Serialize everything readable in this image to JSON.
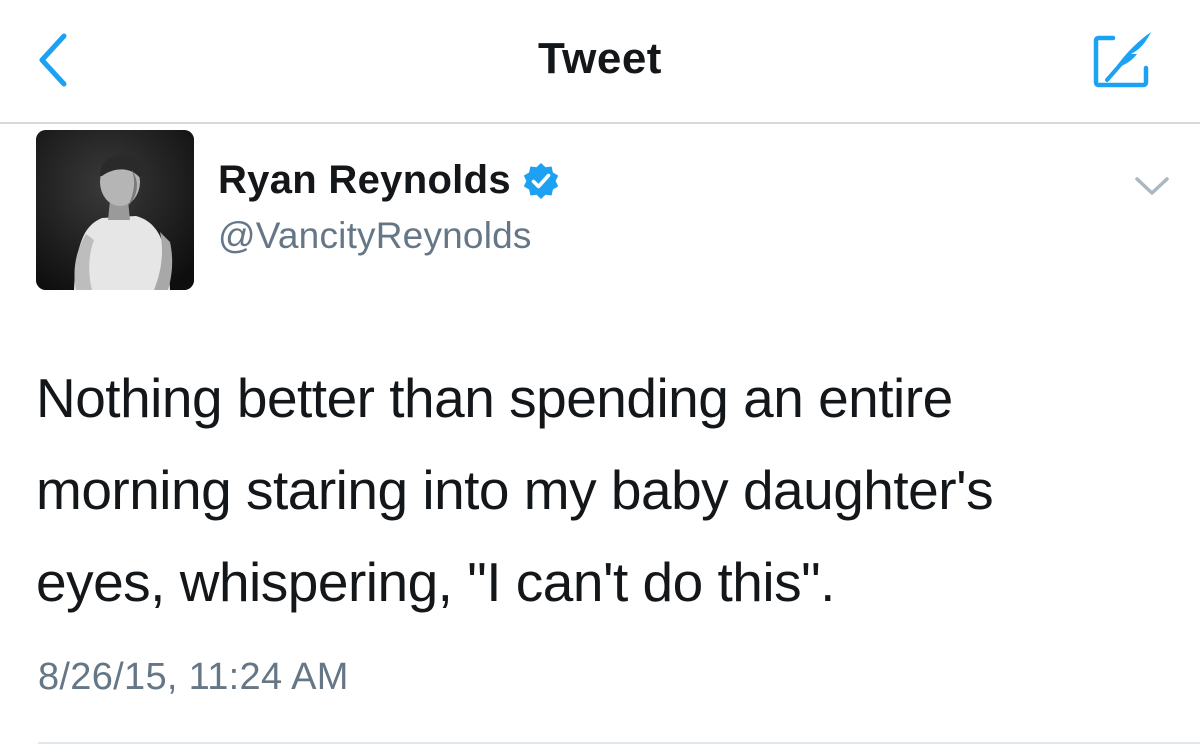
{
  "navbar": {
    "back_icon": "chevron-left-icon",
    "title": "Tweet",
    "compose_icon": "compose-quill-icon",
    "accent_color": "#1da1f2"
  },
  "tweet": {
    "author": {
      "name": "Ryan Reynolds",
      "handle": "@VancityReynolds",
      "verified": true,
      "verified_icon": "verified-badge-icon",
      "avatar": "profile-photo"
    },
    "more_icon": "chevron-down-icon",
    "text_lines": [
      "Nothing better than spending an entire",
      "morning staring into my baby daughter's",
      "eyes, whispering, \"I can't do this\"."
    ],
    "timestamp": "8/26/15, 11:24 AM"
  },
  "colors": {
    "text_primary": "#14171a",
    "text_secondary": "#657786",
    "divider": "#d5d9dd",
    "verified": "#1da1f2"
  }
}
